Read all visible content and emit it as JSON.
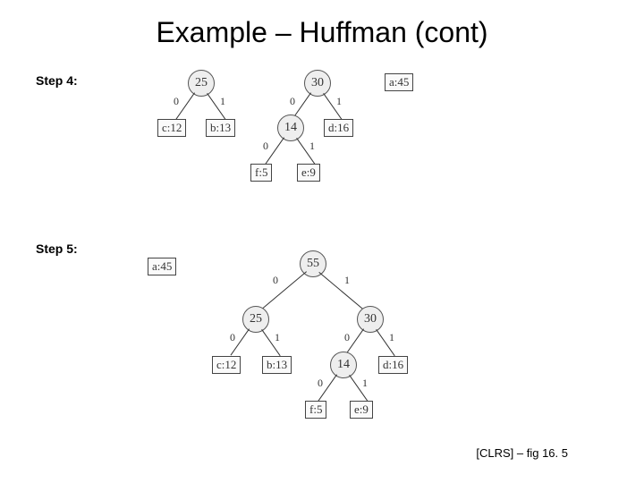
{
  "title": "Example – Huffman (cont)",
  "step4_label": "Step 4:",
  "step5_label": "Step 5:",
  "citation": "[CLRS] – fig 16. 5",
  "step4": {
    "extraLeaf": "a:45",
    "tree25": {
      "root": "25",
      "edges": {
        "l": "0",
        "r": "1"
      },
      "leftLeaf": "c:12",
      "rightLeaf": "b:13"
    },
    "tree30": {
      "root": "30",
      "edges": {
        "l": "0",
        "r": "1"
      },
      "rightLeaf": "d:16",
      "sub14": {
        "root": "14",
        "edges": {
          "l": "0",
          "r": "1"
        },
        "leftLeaf": "f:5",
        "rightLeaf": "e:9"
      }
    }
  },
  "step5": {
    "extraLeaf": "a:45",
    "tree55": {
      "root": "55",
      "edges": {
        "l": "0",
        "r": "1"
      },
      "left25": {
        "root": "25",
        "edges": {
          "l": "0",
          "r": "1"
        },
        "leftLeaf": "c:12",
        "rightLeaf": "b:13"
      },
      "right30": {
        "root": "30",
        "edges": {
          "l": "0",
          "r": "1"
        },
        "rightLeaf": "d:16",
        "sub14": {
          "root": "14",
          "edges": {
            "l": "0",
            "r": "1"
          },
          "leftLeaf": "f:5",
          "rightLeaf": "e:9"
        }
      }
    }
  }
}
